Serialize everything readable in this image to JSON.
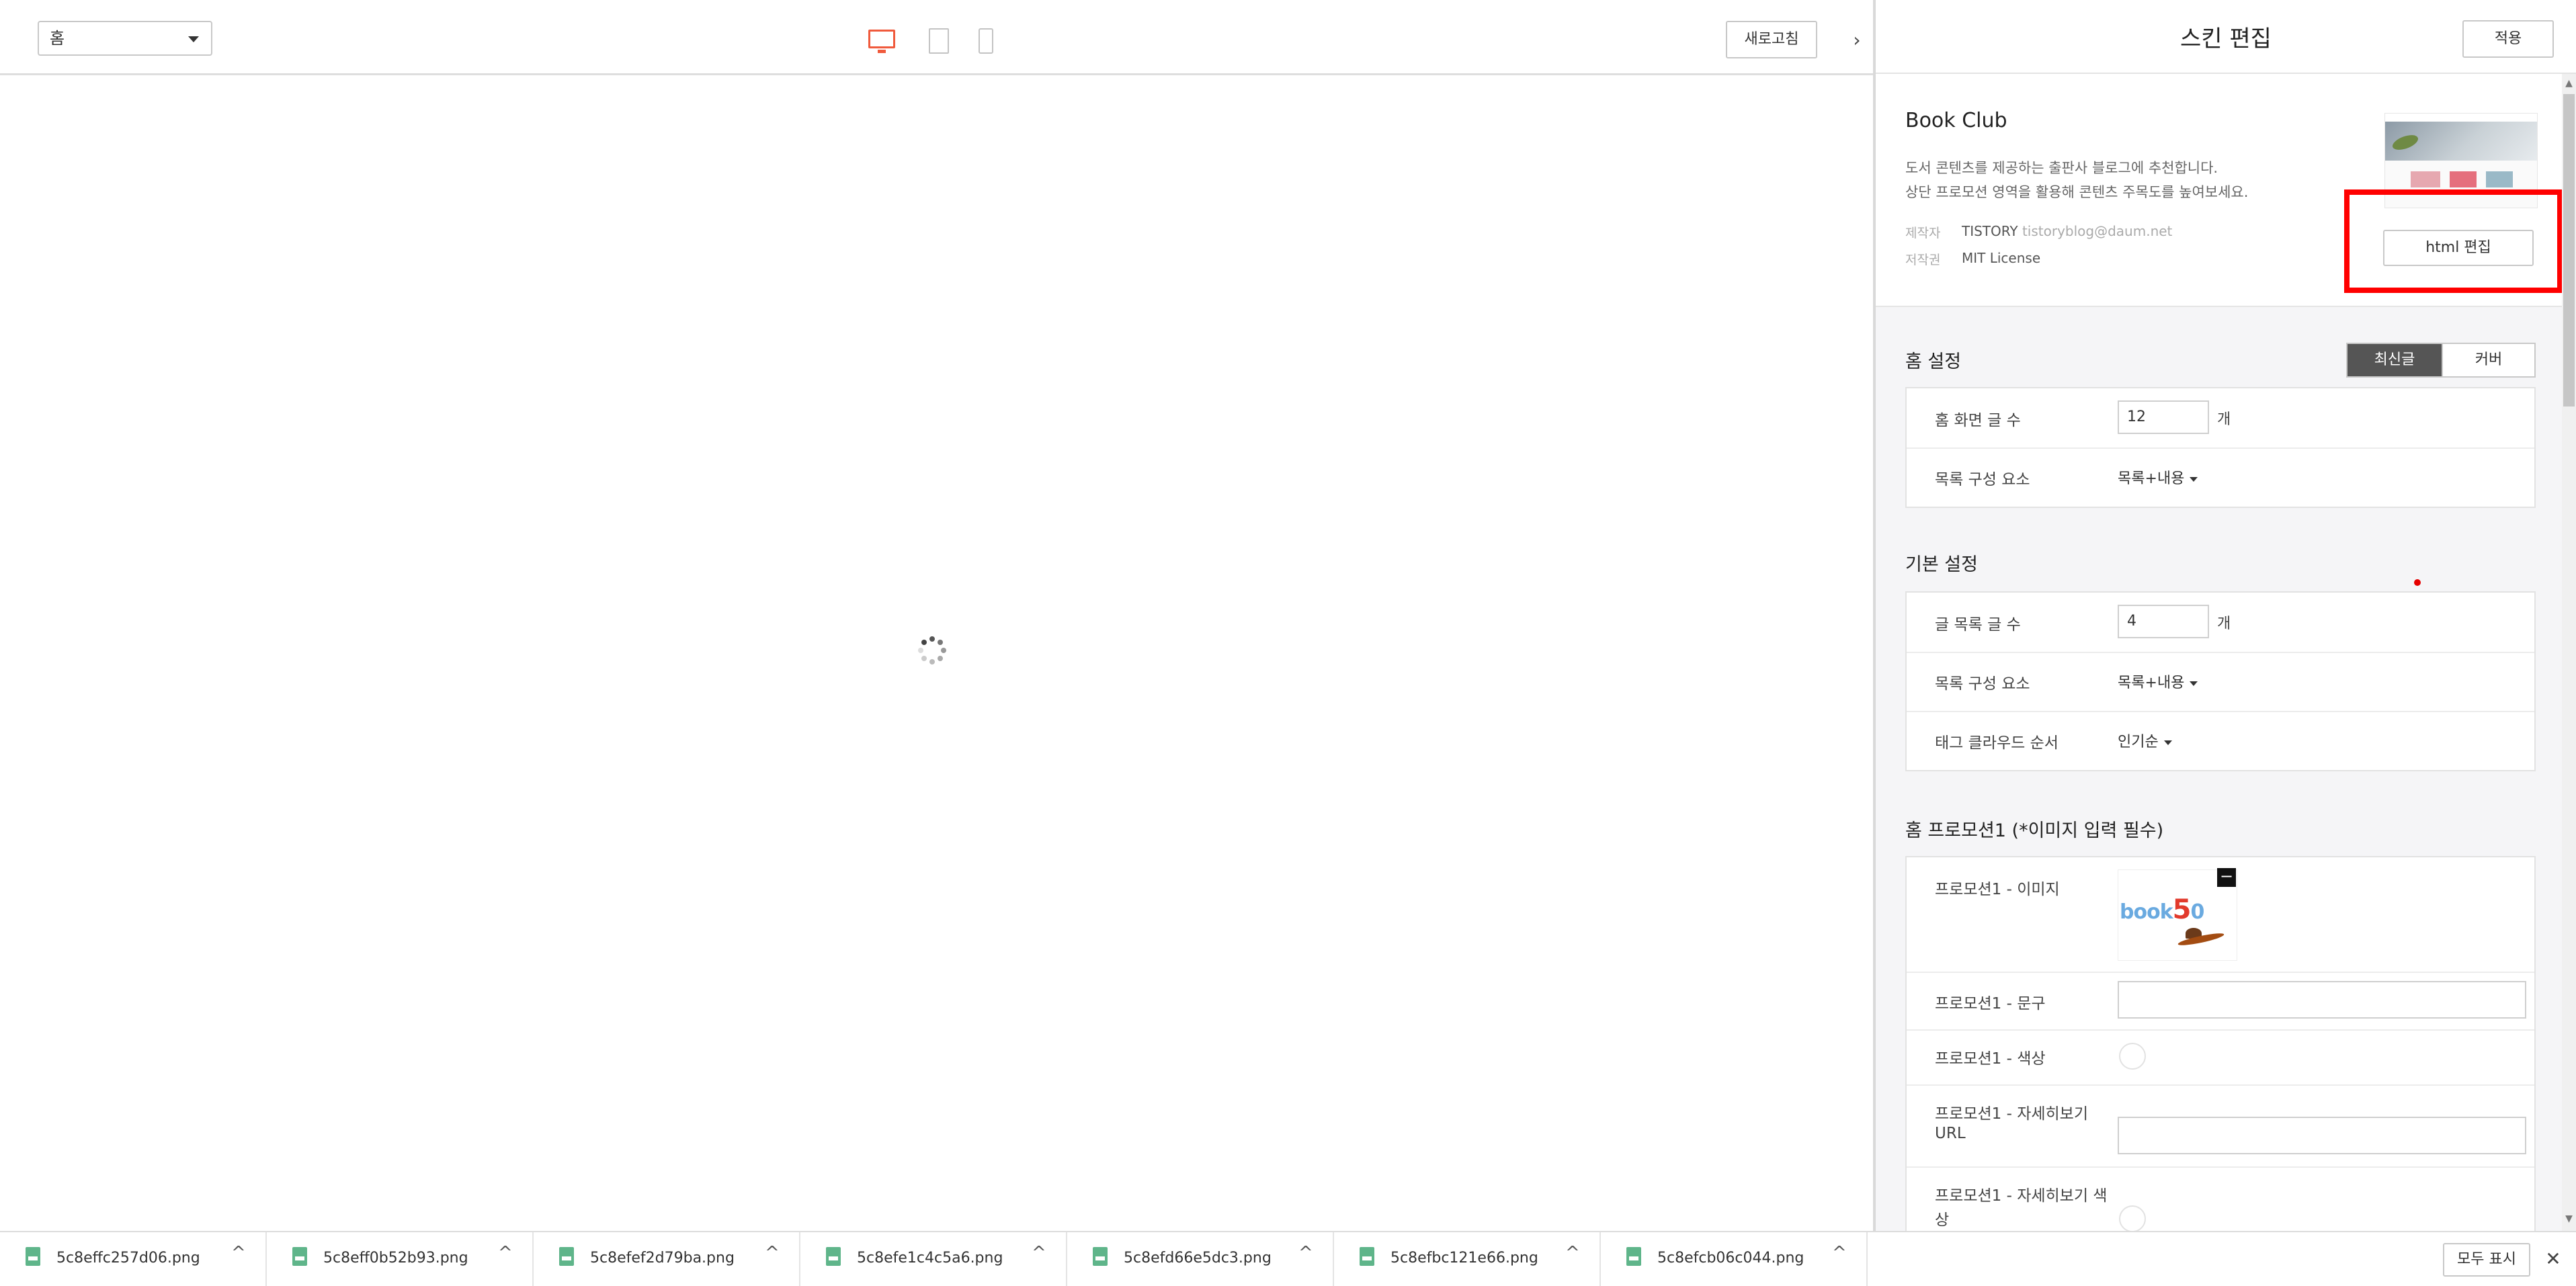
{
  "preview": {
    "page_select": "홈",
    "refresh_label": "새로고침",
    "toggle_glyph": "›"
  },
  "editor": {
    "title": "스킨 편집",
    "apply_label": "적용",
    "skin": {
      "name": "Book Club",
      "desc_1": "도서 콘텐츠를 제공하는 출판사 블로그에 추천합니다.",
      "desc_2": "상단 프로모션 영역을 활용해 콘텐츠 주목도를 높여보세요.",
      "maker_label": "제작자",
      "maker_value": "TISTORY",
      "maker_email": "tistoryblog@daum.net",
      "copyright_label": "저작권",
      "copyright_value": "MIT License",
      "html_edit_label": "html 편집"
    },
    "home_settings": {
      "title": "홈 설정",
      "seg_recent": "최신글",
      "seg_cover": "커버",
      "rows": [
        {
          "label": "홈 화면 글 수",
          "value": "12",
          "unit": "개"
        },
        {
          "label": "목록 구성 요소",
          "value": "목록+내용"
        }
      ]
    },
    "basic_settings": {
      "title": "기본 설정",
      "rows": [
        {
          "label": "글 목록 글 수",
          "value": "4",
          "unit": "개"
        },
        {
          "label": "목록 구성 요소",
          "value": "목록+내용"
        },
        {
          "label": "태그 클라우드 순서",
          "value": "인기순"
        }
      ]
    },
    "promo1": {
      "title": "홈 프로모션1 (*이미지 입력 필수)",
      "image_label": "프로모션1 - 이미지",
      "image_text_a": "book",
      "image_text_b": "5",
      "image_text_c": "0",
      "remove_glyph": "−",
      "text_label": "프로모션1 - 문구",
      "color_label": "프로모션1 - 색상",
      "url_label_1": "프로모션1 - 자세히보기",
      "url_label_2": "URL",
      "btn_color_label_1": "프로모션1 - 자세히보기 색",
      "btn_color_label_2": "상"
    }
  },
  "downloads": {
    "items": [
      "5c8effc257d06.png",
      "5c8eff0b52b93.png",
      "5c8efef2d79ba.png",
      "5c8efe1c4c5a6.png",
      "5c8efd66e5dc3.png",
      "5c8efbc121e66.png",
      "5c8efcb06c044.png"
    ],
    "chevron": "^",
    "show_all_label": "모두 표시",
    "close_glyph": "✕"
  },
  "colors": {
    "accent_device": "#f05a3c",
    "highlight": "#ff0000",
    "segment_active": "#555555"
  }
}
